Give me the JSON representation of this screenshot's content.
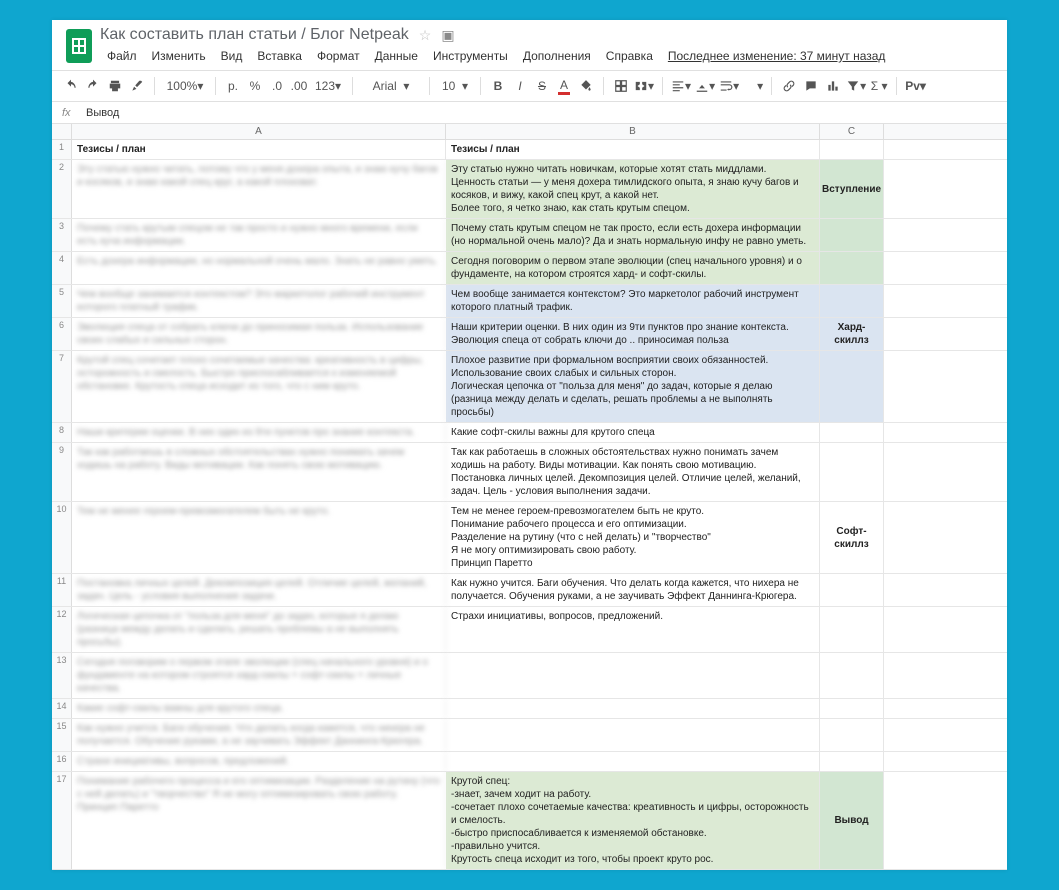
{
  "doc": {
    "title": "Как составить план статьи / Блог Netpeak"
  },
  "menubar": [
    "Файл",
    "Изменить",
    "Вид",
    "Вставка",
    "Формат",
    "Данные",
    "Инструменты",
    "Дополнения",
    "Справка"
  ],
  "last_change": "Последнее изменение: 37 минут назад",
  "toolbar": {
    "zoom": "100%",
    "money": "р.",
    "percent": "%",
    "dec_less": ".0",
    "dec_more": ".00",
    "more_fmt": "123",
    "font": "Arial",
    "size": "10",
    "addon": "Pv"
  },
  "fx": {
    "label": "fx",
    "value": "Вывод"
  },
  "columns": [
    "A",
    "B",
    "C"
  ],
  "rows": [
    {
      "n": "1",
      "a": "Тезисы / план",
      "b": "Тезисы / план",
      "c": "",
      "head": true
    },
    {
      "n": "2",
      "a": "Эту статью нужно читать, потому что у меня дохера опыта, и знаю кучу багов и косяков, и знаю какой спец круг, а какой плоховат.",
      "b": "Эту статью нужно читать новичкам, которые хотят стать миддлами.\nЦенность статьи — у меня дохера тимлидского опыта, я знаю кучу багов и косяков, и вижу, какой спец крут, а какой нет.\nБолее того, я четко знаю, как стать крутым спецом.",
      "c": "Вступление",
      "bstyle": "bg-green",
      "cstyle": "bg-gb merge-top"
    },
    {
      "n": "3",
      "a": "Почему стать крутым спецом не так просто и нужно много времени, если есть куча информации.",
      "b": "Почему стать крутым спецом не так просто, если есть дохера информации (но нормальной очень мало)? Да и знать нормальную инфу не равно уметь.",
      "c": "",
      "bstyle": "bg-green",
      "cstyle": "bg-gb merge-top"
    },
    {
      "n": "4",
      "a": "Есть дохера информации, но нормальной очень мало. Знать не равно уметь.",
      "b": "Сегодня поговорим о первом этапе эволюции (спец начального уровня) и о фундаменте, на котором строятся хард- и софт-скилы.",
      "c": "",
      "bstyle": "bg-green",
      "cstyle": "bg-gb"
    },
    {
      "n": "5",
      "a": "Чем вообще занимается контекстом? Это маркетолог рабочий инструмент которого платный трафик.",
      "b": "Чем вообще занимается контекстом? Это маркетолог рабочий инструмент которого платный трафик.",
      "c": "",
      "bstyle": "bg-blue",
      "cstyle": "bg-blue merge-top"
    },
    {
      "n": "6",
      "a": "Эволюция спеца от собрать ключи до приносимая польза. Использование своих слабых и сильных сторон.",
      "b": "Наши критерии оценки. В них один из 9ти пунктов про знание контекста.\nЭволюция спеца от собрать ключи до .. приносимая польза",
      "c": "Хард-скиллз",
      "bstyle": "bg-blue",
      "cstyle": "bg-blue merge-top"
    },
    {
      "n": "7",
      "a": "Крутой спец сочетает плохо сочетаемые качества: креативность в цифры, осторожность и смелость. Быстро приспосабливается к изменяемой обстановке. Крутость спеца исходит из того, что с ним круто.",
      "b": "Плохое развитие при формальном восприятии своих обязанностей.\nИспользование своих слабых и сильных сторон.\nЛогическая цепочка от \"польза для меня\" до задач, которые я делаю (разница между делать и сделать, решать проблемы а не выполнять просьбы)",
      "c": "",
      "bstyle": "bg-blue",
      "cstyle": "bg-blue"
    },
    {
      "n": "8",
      "a": "Наши критерии оценки. В них один из 9ти пунктов про знание контекста.",
      "b": "Какие софт-скилы важны для крутого спеца",
      "c": "",
      "cstyle": "merge-top"
    },
    {
      "n": "9",
      "a": "Так как работаешь в сложных обстоятельствах нужно понимать зачем ходишь на работу. Виды мотивации. Как понять свою мотивацию.",
      "b": "Так как работаешь в сложных обстоятельствах нужно понимать зачем ходишь на работу. Виды мотивации. Как понять свою мотивацию.\nПостановка личных целей. Декомпозиция целей. Отличие целей, желаний, задач. Цель - условия выполнения задачи.",
      "c": "",
      "cstyle": "merge-top"
    },
    {
      "n": "10",
      "a": "Тем не менее героем-превозмогателем быть не круто.",
      "b": "Тем не менее героем-превозмогателем быть не круто.\nПонимание рабочего процесса и его оптимизации.\nРазделение на рутину (что с ней делать) и \"творчество\"\nЯ не могу оптимизировать свою работу.\nПринцип Паретто",
      "c": "Софт-скиллз",
      "cstyle": "merge-top"
    },
    {
      "n": "11",
      "a": "Постановка личных целей. Декомпозиция целей. Отличие целей, желаний, задач. Цель - условия выполнения задачи.",
      "b": "Как нужно учится. Баги обучения. Что делать когда кажется, что нихера не получается. Обучения руками, а не заучивать Эффект Даннинга-Крюгера.",
      "c": "",
      "cstyle": "merge-top"
    },
    {
      "n": "12",
      "a": "Логическая цепочка от \"польза для меня\" до задач, которые я делаю (разница между делать и сделать, решать проблемы а не выполнять просьбы).",
      "b": "Страхи инициативы, вопросов, предложений.",
      "c": "",
      "cstyle": "merge-top"
    },
    {
      "n": "13",
      "a": "Сегодня поговорим о первом этапе эволюции (спец начального уровня) и о фундаменте на котором строятся хард-скилы + софт-скилы + личные качества.",
      "b": "",
      "c": "",
      "cstyle": "merge-top"
    },
    {
      "n": "14",
      "a": "Какие софт-скилы важны для крутого спеца.",
      "b": "",
      "c": "",
      "cstyle": "merge-top"
    },
    {
      "n": "15",
      "a": "Как нужно учится. Баги обучения. Что делать когда кажется, что нихера не получается. Обучение руками, а не заучивать Эффект Даннинга-Крюгера.",
      "b": "",
      "c": "",
      "cstyle": "merge-top"
    },
    {
      "n": "16",
      "a": "Страхи инициативы, вопросов, предложений.",
      "b": "",
      "c": ""
    },
    {
      "n": "17",
      "a": "Понимание рабочего процесса и его оптимизации.\nРазделение на рутину (что с ней делать) и \"творчество\"\nЯ не могу оптимизировать свою работу.\nПринцип Паретто",
      "b": "Крутой спец:\n-знает, зачем ходит на работу.\n-сочетает плохо сочетаемые качества: креативность и цифры, осторожность и смелость.\n-быстро приспосабливается к изменяемой обстановке.\n-правильно учится.\nКрутость спеца исходит из того, чтобы проект круто рос.",
      "c": "Вывод",
      "bstyle": "bg-green",
      "cstyle": "bg-gb"
    }
  ]
}
